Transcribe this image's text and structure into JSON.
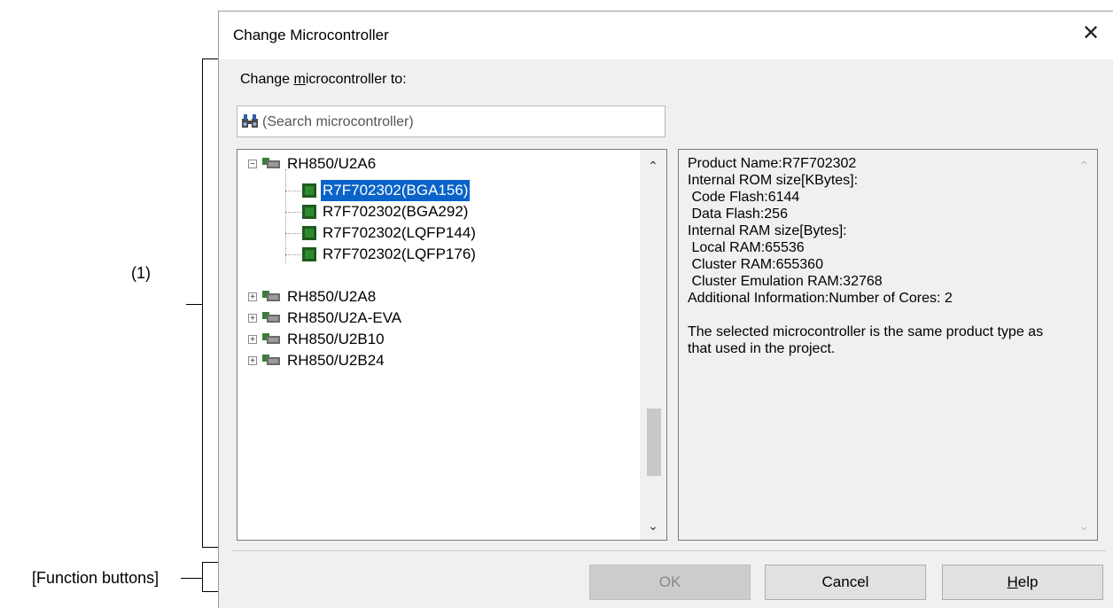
{
  "annotations": {
    "region1": "(1)",
    "function_buttons": "[Function buttons]"
  },
  "dialog": {
    "title": "Change Microcontroller",
    "prompt_prefix": "Change ",
    "prompt_underlined": "m",
    "prompt_suffix": "icrocontroller to:",
    "search_placeholder": "(Search microcontroller)",
    "tree": {
      "groups": [
        {
          "label": "RH850/U2A6",
          "expanded": true,
          "children": [
            "R7F702302(BGA156)",
            "R7F702302(BGA292)",
            "R7F702302(LQFP144)",
            "R7F702302(LQFP176)"
          ]
        },
        {
          "label": "RH850/U2A8",
          "expanded": false
        },
        {
          "label": "RH850/U2A-EVA",
          "expanded": false
        },
        {
          "label": "RH850/U2B10",
          "expanded": false
        },
        {
          "label": "RH850/U2B24",
          "expanded": false
        }
      ],
      "selected": "R7F702302(BGA156)"
    },
    "info_text": "Product Name:R7F702302\nInternal ROM size[KBytes]:\n Code Flash:6144\n Data Flash:256\nInternal RAM size[Bytes]:\n Local RAM:65536\n Cluster RAM:655360\n Cluster Emulation RAM:32768\nAdditional Information:Number of Cores: 2\n\nThe selected microcontroller is the same product type as that used in the project.",
    "buttons": {
      "ok": "OK",
      "cancel": "Cancel",
      "help_underlined": "H",
      "help_rest": "elp"
    }
  }
}
